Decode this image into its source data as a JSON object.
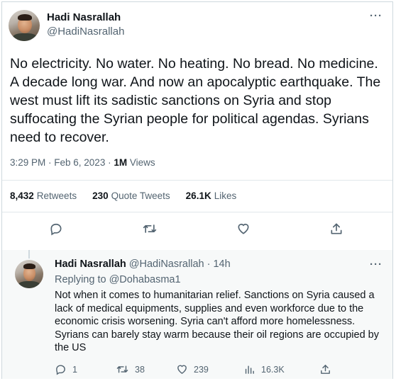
{
  "main_tweet": {
    "author_name": "Hadi Nasrallah",
    "author_handle": "@HadiNasrallah",
    "more": "···",
    "text": "No electricity. No water. No heating. No bread. No medicine. A decade long war. And now an apocalyptic earthquake. The west must lift its sadistic sanctions on Syria and stop suffocating the Syrian people for political agendas. Syrians need to recover.",
    "time": "3:29 PM · Feb 6, 2023 · ",
    "views_count": "1M",
    "views_label": " Views",
    "stats": {
      "retweets_count": "8,432",
      "retweets_label": "Retweets",
      "quotes_count": "230",
      "quotes_label": "Quote Tweets",
      "likes_count": "26.1K",
      "likes_label": "Likes"
    },
    "actions": [
      "reply-icon",
      "retweet-icon",
      "like-icon",
      "share-icon"
    ]
  },
  "reply": {
    "author_name": "Hadi Nasrallah",
    "author_handle": "@HadiNasrallah",
    "time": "· 14h",
    "more": "···",
    "replying_prefix": "Replying to ",
    "replying_to": "@Dohabasma1",
    "text": "Not when it comes to humanitarian relief. Sanctions on Syria caused a lack of medical equipments, supplies and even workforce due to the economic crisis worsening. Syria can't afford more homelessness. Syrians can barely stay warm because their oil regions are occupied by the US",
    "counts": {
      "replies": "1",
      "retweets": "38",
      "likes": "239",
      "views": "16.3K"
    }
  },
  "colors": {
    "text": "#0f1419",
    "secondary": "#536471",
    "reply_bg": "#f7f9f9"
  }
}
